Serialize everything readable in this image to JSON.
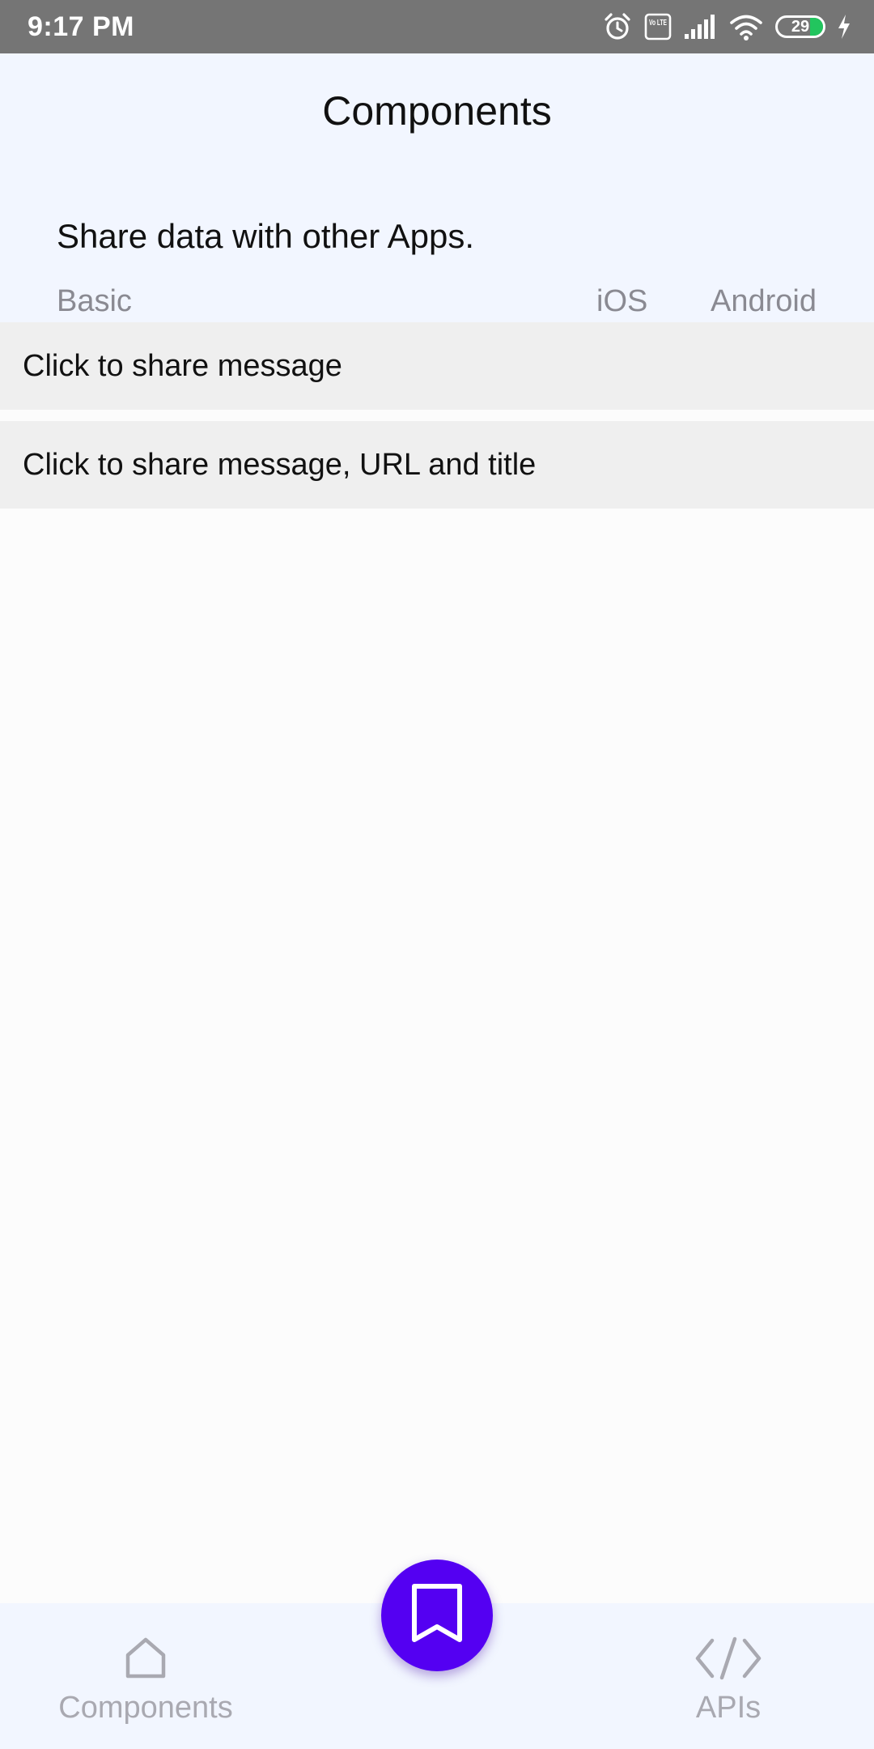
{
  "status_bar": {
    "time": "9:17 PM",
    "battery_level": "29",
    "battery_fill_fraction": 0.29,
    "icons": [
      "alarm-icon",
      "volte-icon",
      "signal-icon",
      "wifi-icon",
      "battery-icon",
      "charging-icon"
    ],
    "volte_label": "Vo LTE"
  },
  "header": {
    "title": "Components",
    "description": "Share data with other Apps.",
    "columns": {
      "basic": "Basic",
      "ios": "iOS",
      "android": "Android"
    }
  },
  "actions": [
    {
      "label": "Click to share message"
    },
    {
      "label": "Click to share message, URL and title"
    }
  ],
  "bottom_nav": {
    "items": [
      {
        "label": "Components",
        "icon": "home-icon"
      },
      {
        "label": "APIs",
        "icon": "code-icon"
      }
    ],
    "fab_icon": "bookmark-icon"
  },
  "colors": {
    "header_bg": "#f2f6ff",
    "row_bg": "#efefef",
    "fab_bg": "#5400f2",
    "muted_text": "#8a8a92",
    "nav_inactive": "#a9a9b1",
    "battery_fill": "#22c55e",
    "status_bar_bg": "#757575"
  }
}
